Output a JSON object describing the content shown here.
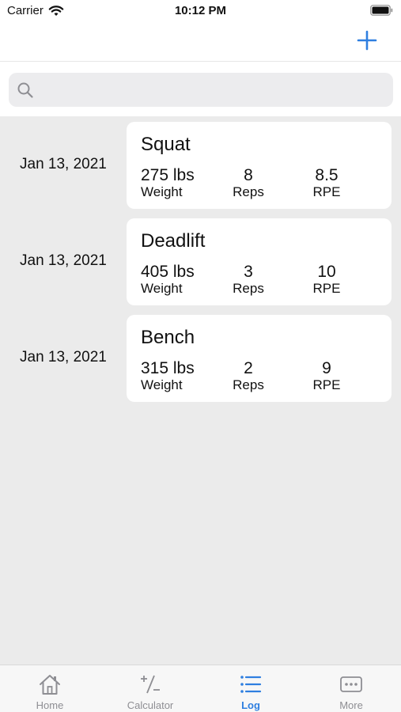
{
  "status_bar": {
    "carrier": "Carrier",
    "time": "10:12 PM"
  },
  "nav": {
    "add_icon": "plus-icon"
  },
  "search": {
    "placeholder": "",
    "value": "",
    "icon": "search-icon"
  },
  "log": [
    {
      "date": "Jan 13, 2021",
      "exercise": "Squat",
      "weight": "275 lbs",
      "weight_label": "Weight",
      "reps": "8",
      "reps_label": "Reps",
      "rpe": "8.5",
      "rpe_label": "RPE"
    },
    {
      "date": "Jan 13, 2021",
      "exercise": "Deadlift",
      "weight": "405 lbs",
      "weight_label": "Weight",
      "reps": "3",
      "reps_label": "Reps",
      "rpe": "10",
      "rpe_label": "RPE"
    },
    {
      "date": "Jan 13, 2021",
      "exercise": "Bench",
      "weight": "315 lbs",
      "weight_label": "Weight",
      "reps": "2",
      "reps_label": "Reps",
      "rpe": "9",
      "rpe_label": "RPE"
    }
  ],
  "tabs": [
    {
      "label": "Home",
      "icon": "house-icon",
      "active": false
    },
    {
      "label": "Calculator",
      "icon": "plus-minus-icon",
      "active": false
    },
    {
      "label": "Log",
      "icon": "list-icon",
      "active": true
    },
    {
      "label": "More",
      "icon": "ellipsis-icon",
      "active": false
    }
  ],
  "colors": {
    "accent": "#2f7fe0",
    "background": "#ebebeb",
    "card": "#ffffff",
    "inactive_tab": "#8e8e93"
  }
}
